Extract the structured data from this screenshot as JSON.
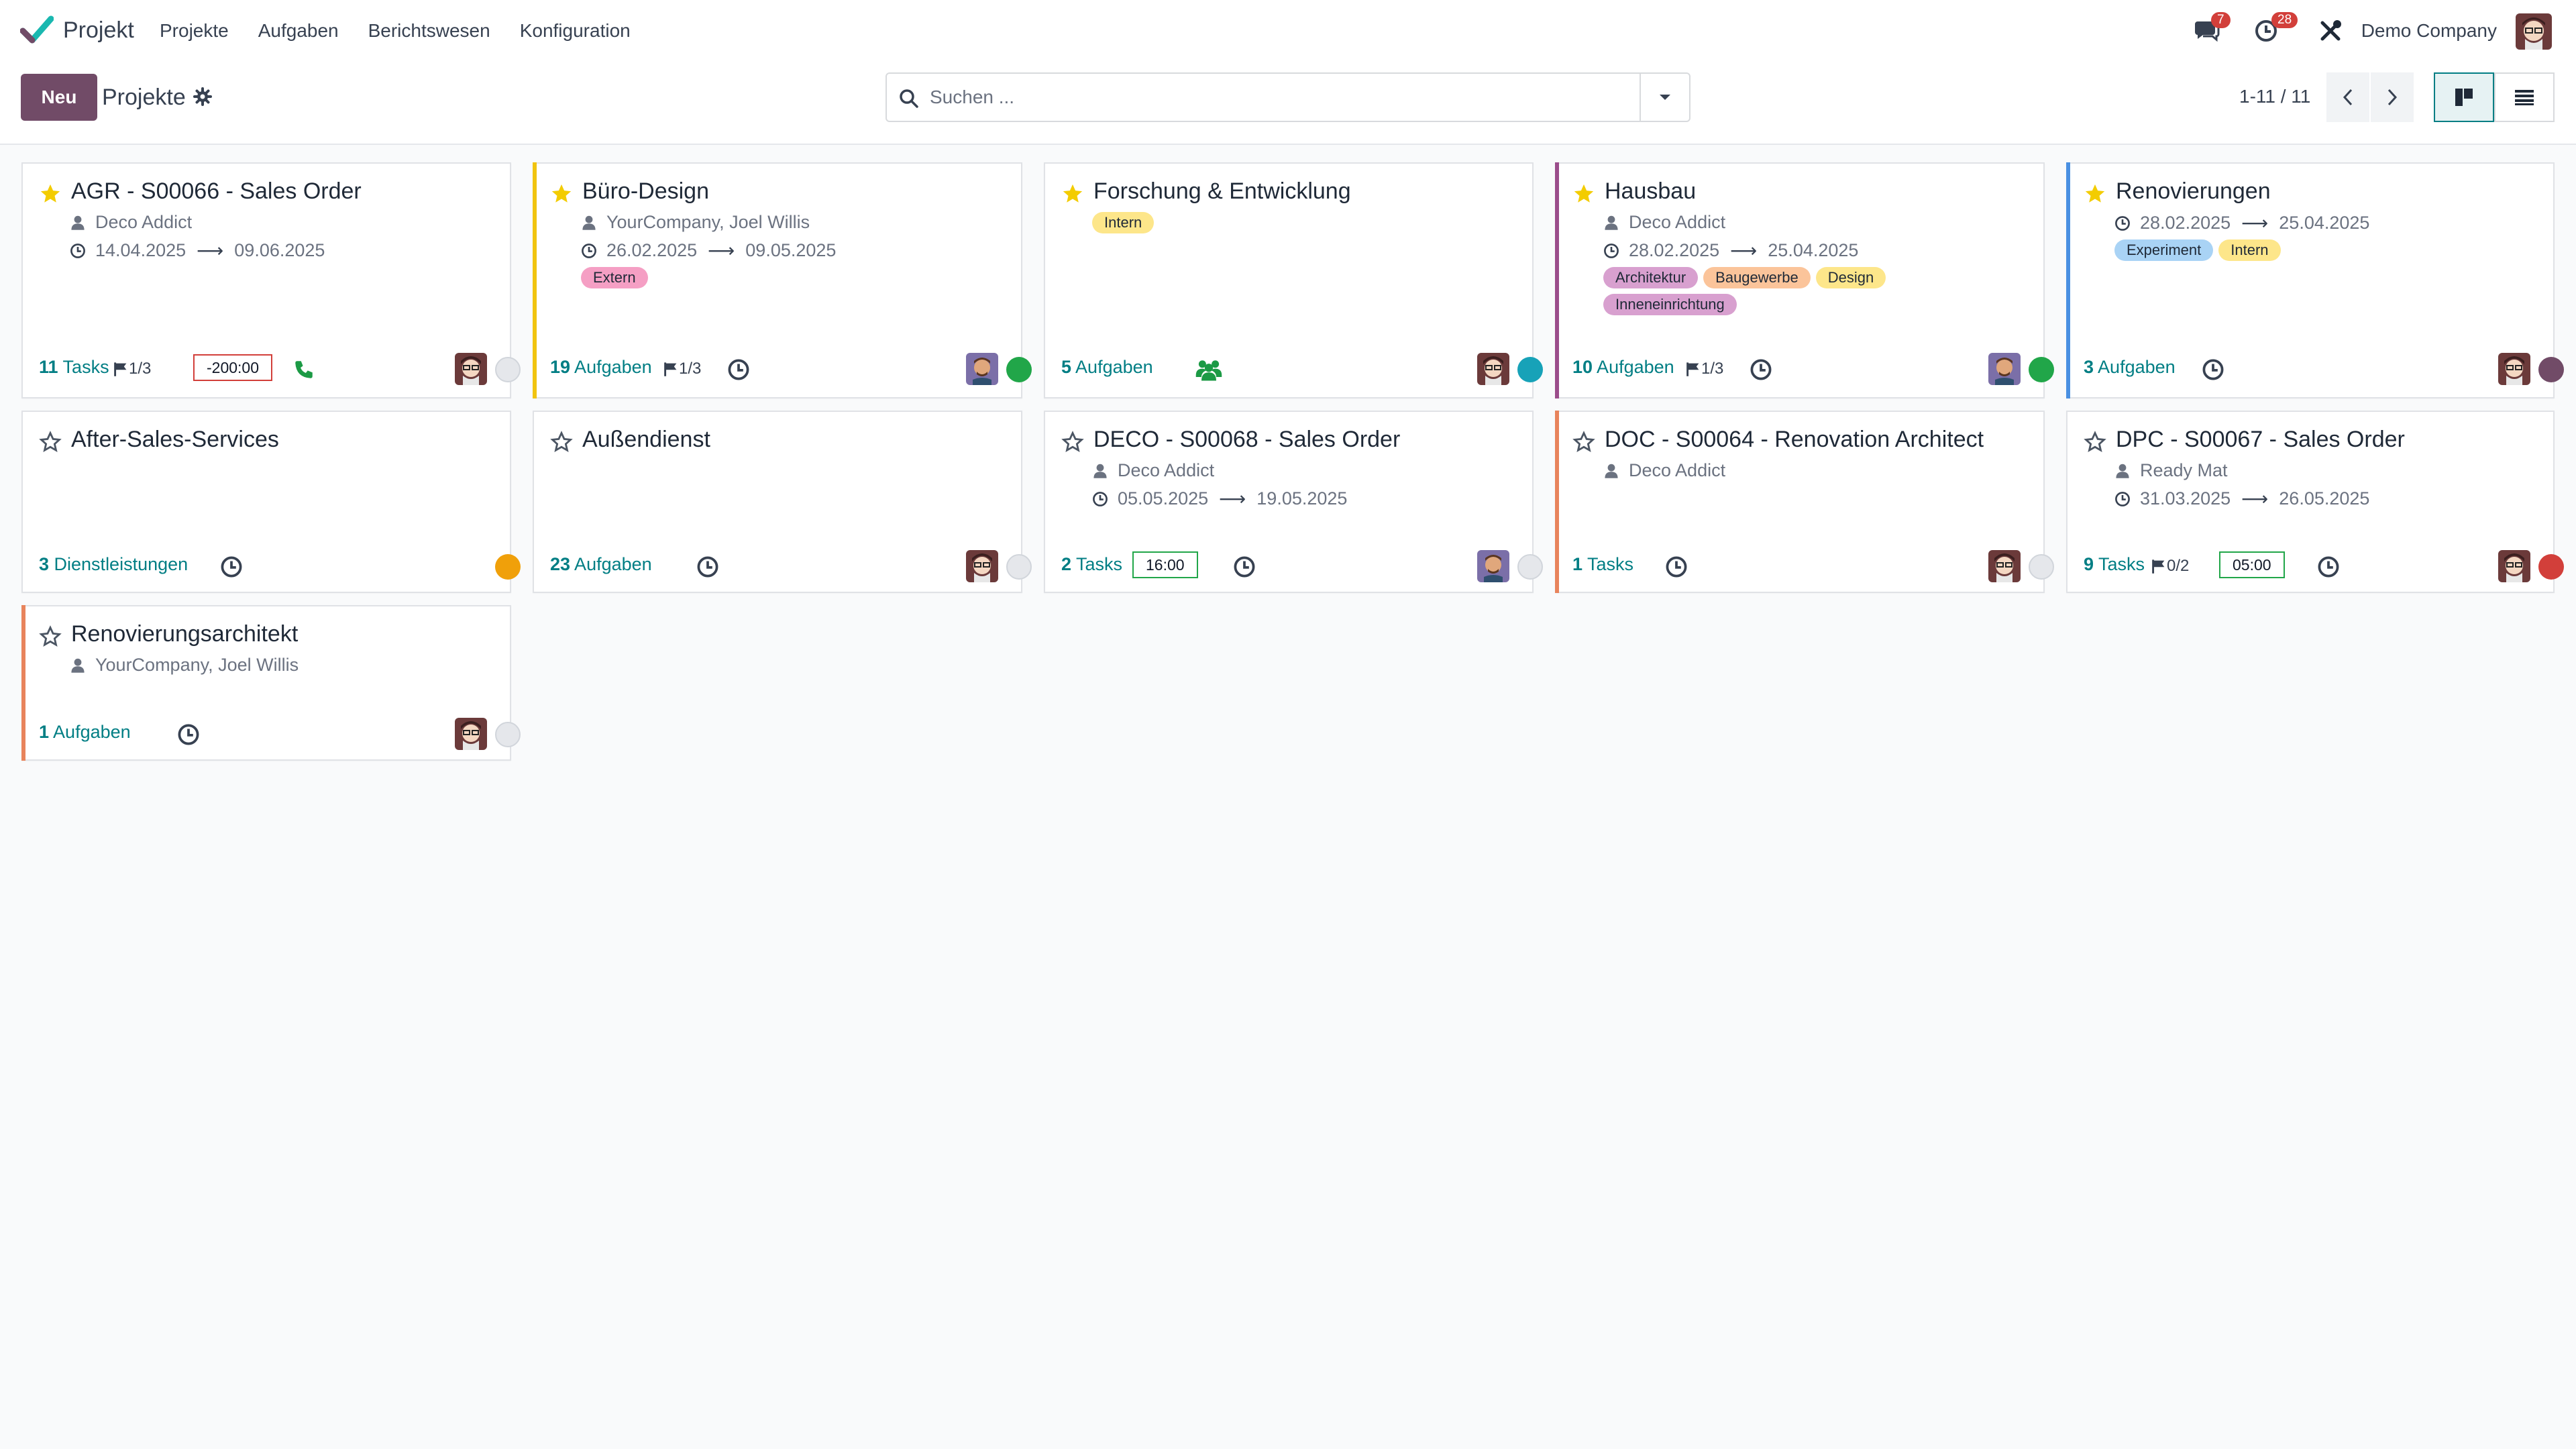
{
  "app": {
    "name": "Projekt",
    "menu": [
      "Projekte",
      "Aufgaben",
      "Berichtswesen",
      "Konfiguration"
    ],
    "messages_badge": "7",
    "activities_badge": "28",
    "company": "Demo Company"
  },
  "control": {
    "new_label": "Neu",
    "breadcrumb": "Projekte",
    "search_placeholder": "Suchen ...",
    "pager": "1-11 / 11"
  },
  "colors": {
    "primary": "#714b67",
    "link": "#017e84",
    "star": "#f3cc00"
  },
  "cards": [
    {
      "title": "AGR - S00066 - Sales Order",
      "favorite": true,
      "customer": "Deco Addict",
      "date_start": "14.04.2025",
      "date_end": "09.06.2025",
      "count_number": "11",
      "count_label": " Tasks",
      "milestone": "1/3",
      "deadline": "-200:00",
      "activity_icon": "phone-icon",
      "status": "none"
    },
    {
      "title": "Büro-Design",
      "favorite": true,
      "customer": "YourCompany, Joel Willis",
      "date_start": "26.02.2025",
      "date_end": "09.05.2025",
      "tags": [
        "Extern"
      ],
      "count_number": "19",
      "count_label": " Aufgaben",
      "milestone": "1/3",
      "activity_icon": "clock-icon",
      "status": "green"
    },
    {
      "title": "Forschung & Entwicklung",
      "favorite": true,
      "tags": [
        "Intern"
      ],
      "count_number": "5",
      "count_label": " Aufgaben",
      "activity_icon": "users-icon",
      "status": "blue"
    },
    {
      "title": "Hausbau",
      "favorite": true,
      "customer": "Deco Addict",
      "date_start": "28.02.2025",
      "date_end": "25.04.2025",
      "tags": [
        "Architektur",
        "Baugewerbe",
        "Design",
        "Inneneinrichtung"
      ],
      "count_number": "10",
      "count_label": " Aufgaben",
      "milestone": "1/3",
      "activity_icon": "clock-icon",
      "status": "green"
    },
    {
      "title": "Renovierungen",
      "favorite": true,
      "date_start": "28.02.2025",
      "date_end": "25.04.2025",
      "tags": [
        "Experiment",
        "Intern"
      ],
      "count_number": "3",
      "count_label": " Aufgaben",
      "activity_icon": "clock-icon",
      "status": "purple"
    },
    {
      "title": "After-Sales-Services",
      "favorite": false,
      "count_number": "3",
      "count_label": " Dienstleistungen",
      "activity_icon": "clock-icon",
      "status": "orange"
    },
    {
      "title": "Außendienst",
      "favorite": false,
      "count_number": "23",
      "count_label": " Aufgaben",
      "activity_icon": "clock-icon",
      "status": "none"
    },
    {
      "title": "DECO - S00068 - Sales Order",
      "favorite": false,
      "customer": "Deco Addict",
      "date_start": "05.05.2025",
      "date_end": "19.05.2025",
      "count_number": "2",
      "count_label": " Tasks",
      "deadline": "16:00",
      "activity_icon": "clock-icon",
      "status": "none"
    },
    {
      "title": "DOC - S00064 - Renovation Architect",
      "favorite": false,
      "customer": "Deco Addict",
      "count_number": "1",
      "count_label": " Tasks",
      "activity_icon": "clock-icon",
      "status": "none"
    },
    {
      "title": "DPC - S00067 - Sales Order",
      "favorite": false,
      "customer": "Ready Mat",
      "date_start": "31.03.2025",
      "date_end": "26.05.2025",
      "count_number": "9",
      "count_label": " Tasks",
      "milestone": "0/2",
      "deadline": "05:00",
      "activity_icon": "clock-icon",
      "status": "red"
    },
    {
      "title": "Renovierungsarchitekt",
      "favorite": false,
      "customer": "YourCompany, Joel Willis",
      "count_number": "1",
      "count_label": " Aufgaben",
      "activity_icon": "clock-icon",
      "status": "none"
    }
  ]
}
